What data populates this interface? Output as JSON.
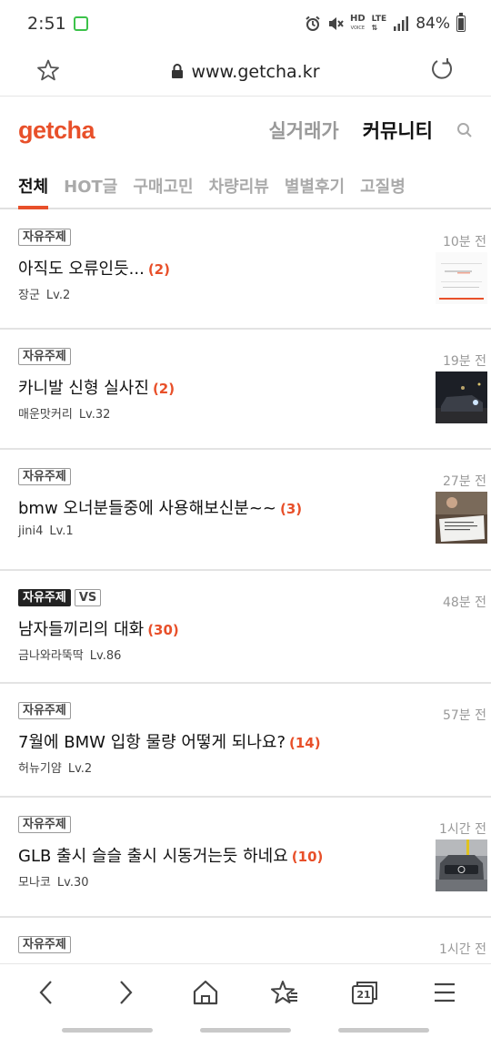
{
  "status_bar": {
    "time": "2:51",
    "hd_label": "HD",
    "voice_label": "VOICE",
    "lte_label": "LTE",
    "battery": "84%"
  },
  "url_bar": {
    "url": "www.getcha.kr"
  },
  "header": {
    "logo": "getcha",
    "nav": [
      "실거래가",
      "커뮤니티"
    ],
    "active_nav": "커뮤니티"
  },
  "tabs": [
    "전체",
    "HOT글",
    "구매고민",
    "차량리뷰",
    "별별후기",
    "고질병"
  ],
  "active_tab": "전체",
  "posts": [
    {
      "badges": [
        "자유주제"
      ],
      "time": "10분 전",
      "title": "아직도 오류인듯...",
      "count": "(2)",
      "author": "장군",
      "level": "Lv.2",
      "thumb": "screenshot"
    },
    {
      "badges": [
        "자유주제"
      ],
      "time": "19분 전",
      "title": "카니발 신형 실사진",
      "count": "(2)",
      "author": "매운맛커리",
      "level": "Lv.32",
      "thumb": "night-car"
    },
    {
      "badges": [
        "자유주제"
      ],
      "time": "27분 전",
      "title": "bmw 오너분들중에 사용해보신분~~",
      "count": "(3)",
      "author": "jini4",
      "level": "Lv.1",
      "thumb": "paper"
    },
    {
      "badges": [
        "자유주제",
        "VS"
      ],
      "time": "48분 전",
      "title": "남자들끼리의 대화",
      "count": "(30)",
      "author": "금나와라뚝딱",
      "level": "Lv.86",
      "thumb": ""
    },
    {
      "badges": [
        "자유주제"
      ],
      "time": "57분 전",
      "title": "7월에 BMW 입항 물량 어떻게 되나요?",
      "count": "(14)",
      "author": "허뉴기얌",
      "level": "Lv.2",
      "thumb": ""
    },
    {
      "badges": [
        "자유주제"
      ],
      "time": "1시간 전",
      "title": "GLB 출시 슬슬 출시 시동거는듯 하네요",
      "count": "(10)",
      "author": "모나코",
      "level": "Lv.30",
      "thumb": "mercedes"
    },
    {
      "badges": [
        "자유주제"
      ],
      "time": "1시간 전",
      "title": "",
      "count": "",
      "author": "",
      "level": "",
      "thumb": ""
    }
  ],
  "bottom_bar": {
    "tab_count": "21"
  },
  "colors": {
    "accent": "#e8502a",
    "status_green": "#3cc24a"
  }
}
